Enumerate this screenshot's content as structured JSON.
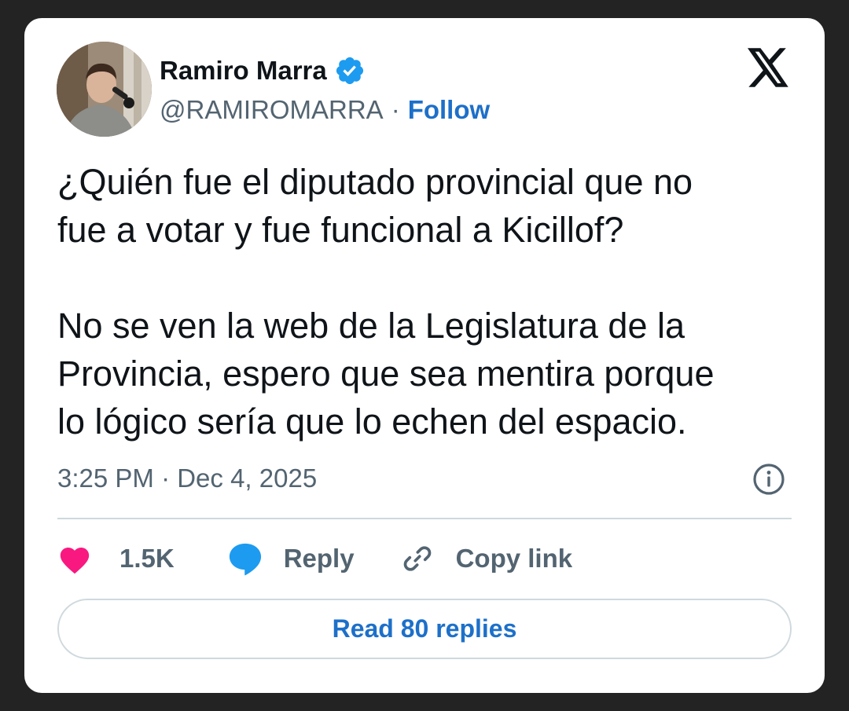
{
  "author": {
    "name": "Ramiro Marra",
    "handle": "@RAMIROMARRA",
    "separator": "·",
    "follow_label": "Follow"
  },
  "tweet": {
    "text": "¿Quién fue el diputado provincial que no\nfue a votar y fue funcional a Kicillof?\n\nNo se ven la web de la Legislatura de la\nProvincia, espero que sea mentira porque\nlo lógico sería que lo echen del espacio.",
    "timestamp": "3:25 PM · Dec 4, 2025"
  },
  "actions": {
    "like_count": "1.5K",
    "reply_label": "Reply",
    "copy_link_label": "Copy link"
  },
  "read_replies_label": "Read 80 replies",
  "icons": {
    "verified": "verified-badge-icon",
    "logo": "x-logo-icon",
    "info": "info-icon",
    "like": "heart-icon",
    "reply": "speech-bubble-icon",
    "link": "link-icon"
  },
  "colors": {
    "background": "#232323",
    "card": "#ffffff",
    "text": "#0f1419",
    "secondary": "#536471",
    "link_blue": "#1d70c9",
    "verified_blue": "#1d9bf0",
    "heart_pink": "#f91880",
    "divider": "#cfd9de"
  }
}
